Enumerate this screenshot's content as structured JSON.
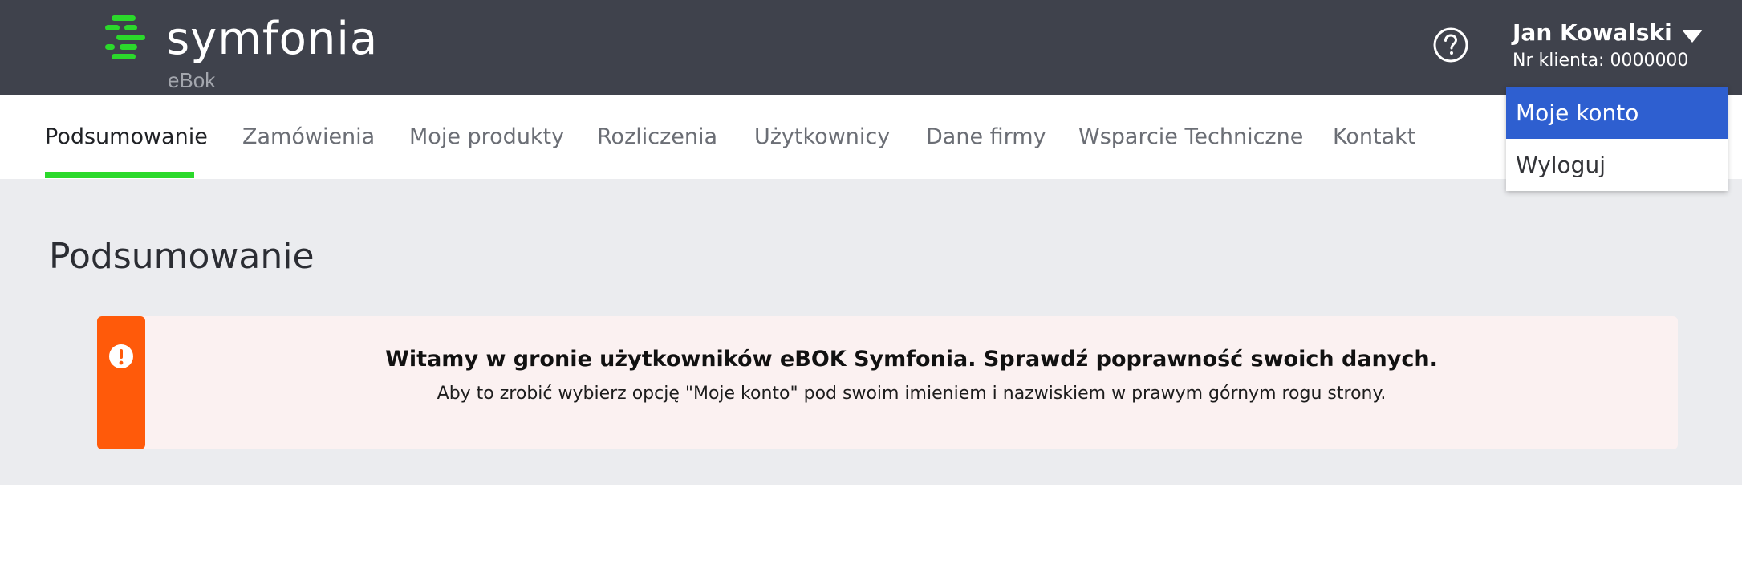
{
  "header": {
    "logo_text": "symfonia",
    "logo_subtitle": "eBok",
    "help_icon": "question-circle-icon",
    "user_name": "Jan Kowalski",
    "client_number": "Nr klienta: 0000000",
    "caret_icon": "caret-down-icon",
    "colors": {
      "background": "#3f424c",
      "logo_green": "#2bd92b"
    }
  },
  "nav": {
    "tabs": [
      {
        "label": "Podsumowanie",
        "active": true
      },
      {
        "label": "Zamówienia"
      },
      {
        "label": "Moje produkty"
      },
      {
        "label": "Rozliczenia"
      },
      {
        "label": "Użytkownicy"
      },
      {
        "label": "Dane firmy"
      },
      {
        "label": "Wsparcie Techniczne"
      },
      {
        "label": "Kontakt"
      }
    ],
    "active_color": "#2bd92b"
  },
  "main": {
    "title": "Podsumowanie",
    "alert": {
      "icon": "exclamation-circle-icon",
      "title": "Witamy w gronie użytkowników eBOK Symfonia. Sprawdź poprawność swoich danych.",
      "body": "Aby to zrobić wybierz opcję \"Moje konto\" pod swoim imieniem i nazwiskiem w prawym górnym rogu strony.",
      "accent_color": "#ff5a0a"
    }
  },
  "user_menu": {
    "items": [
      {
        "label": "Moje konto",
        "selected": true
      },
      {
        "label": "Wyloguj"
      }
    ],
    "selected_color": "#2e5fd0"
  }
}
